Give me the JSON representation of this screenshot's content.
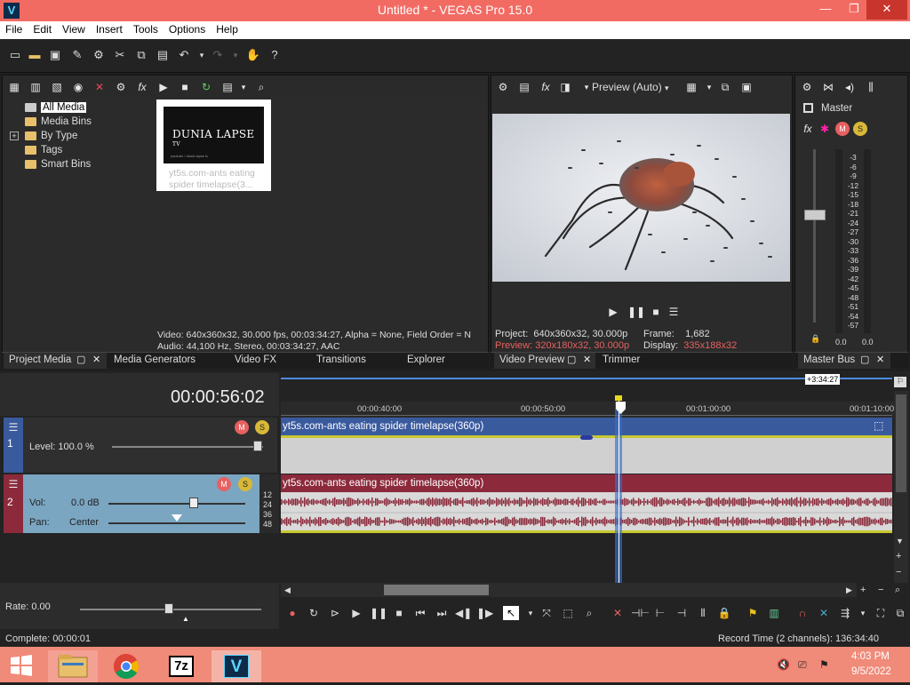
{
  "window": {
    "title": "Untitled * - VEGAS Pro 15.0",
    "logo": "V",
    "minimize": "—",
    "restore": "❐",
    "close": "✕"
  },
  "menu": [
    "File",
    "Edit",
    "View",
    "Insert",
    "Tools",
    "Options",
    "Help"
  ],
  "media_tree": [
    "All Media",
    "Media Bins",
    "By Type",
    "Tags",
    "Smart Bins"
  ],
  "thumb": {
    "brand": "DUNIA LAPSE",
    "brand_tm": "TV",
    "small": "youtube / dunia lapse tv",
    "caption": "yt5s.com-ants eating spider timelapse(3..."
  },
  "media_info": {
    "video": "Video: 640x360x32, 30.000 fps, 00:03:34:27, Alpha = None, Field Order = N",
    "audio": "Audio: 44,100 Hz, Stereo, 00:03:34:27, AAC"
  },
  "tabs_left": [
    "Project Media",
    "Media Generators",
    "Video FX",
    "Transitions",
    "Explorer"
  ],
  "preview": {
    "mode": "Preview (Auto)",
    "project_label": "Project:",
    "project_value": "640x360x32, 30.000p",
    "preview_label": "Preview:",
    "preview_value": "320x180x32, 30.000p",
    "frame_label": "Frame:",
    "frame_value": "1,682",
    "display_label": "Display:",
    "display_value": "335x188x32"
  },
  "tabs_mid": [
    "Video Preview",
    "Trimmer"
  ],
  "master": {
    "label": "Master",
    "scale": [
      "3",
      "6",
      "9",
      "12",
      "15",
      "18",
      "21",
      "24",
      "27",
      "30",
      "33",
      "36",
      "39",
      "42",
      "45",
      "48",
      "51",
      "54",
      "57"
    ],
    "left_val": "0.0",
    "right_val": "0.0",
    "tab": "Master Bus"
  },
  "timeline": {
    "timecode": "00:00:56:02",
    "end_badge": "+3:34:27",
    "ruler": [
      "00:00:40:00",
      "00:00:50:00",
      "00:01:00:00",
      "00:01:10:00"
    ],
    "track1": {
      "num": "1",
      "level_label": "Level: 100.0 %",
      "clip": "yt5s.com-ants eating spider timelapse(360p)"
    },
    "track2": {
      "num": "2",
      "vol_label": "Vol:",
      "vol_value": "0.0 dB",
      "pan_label": "Pan:",
      "pan_value": "Center",
      "clip": "yt5s.com-ants eating spider timelapse(360p)",
      "scale": [
        "12",
        "24",
        "36",
        "48"
      ]
    },
    "rate": "Rate: 0.00"
  },
  "status": {
    "left": "Complete: 00:00:01",
    "right": "Record Time (2 channels): 136:34:40"
  },
  "taskbar": {
    "time": "4:03 PM",
    "date": "9/5/2022",
    "app_7z": "7z",
    "app_vegas": "V"
  }
}
